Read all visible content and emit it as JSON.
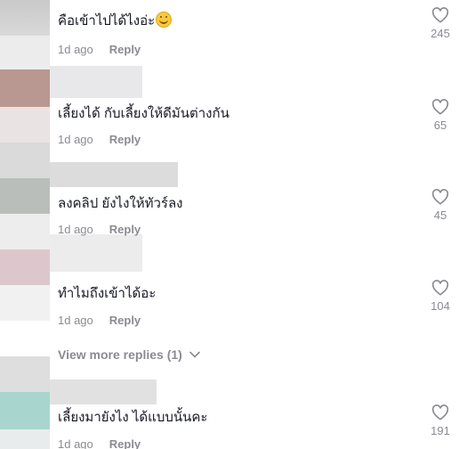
{
  "comments": [
    {
      "text": "คือเข้าไปได้ไงอ่ะ",
      "ago": "1d ago",
      "reply": "Reply",
      "likes": "245",
      "emoji": "grinning-face-sweat"
    },
    {
      "text": "เลี้ยงได้ กับเลี้ยงให้ดีมันต่างกัน",
      "ago": "1d ago",
      "reply": "Reply",
      "likes": "65"
    },
    {
      "text": "ลงคลิป ยังไงให้ทัวร์ลง",
      "ago": "1d ago",
      "reply": "Reply",
      "likes": "45"
    },
    {
      "text": "ทำไมถึงเข้าได้อะ",
      "ago": "1d ago",
      "reply": "Reply",
      "likes": "104"
    },
    {
      "text": "เลี้ยงมายังไง ได้แบบนั้นคะ",
      "ago": "1d ago",
      "reply": "Reply",
      "likes": "191"
    }
  ],
  "view_more": {
    "label": "View more replies (1)"
  },
  "colors": {
    "text": "#161823",
    "muted": "#8a8b91"
  }
}
